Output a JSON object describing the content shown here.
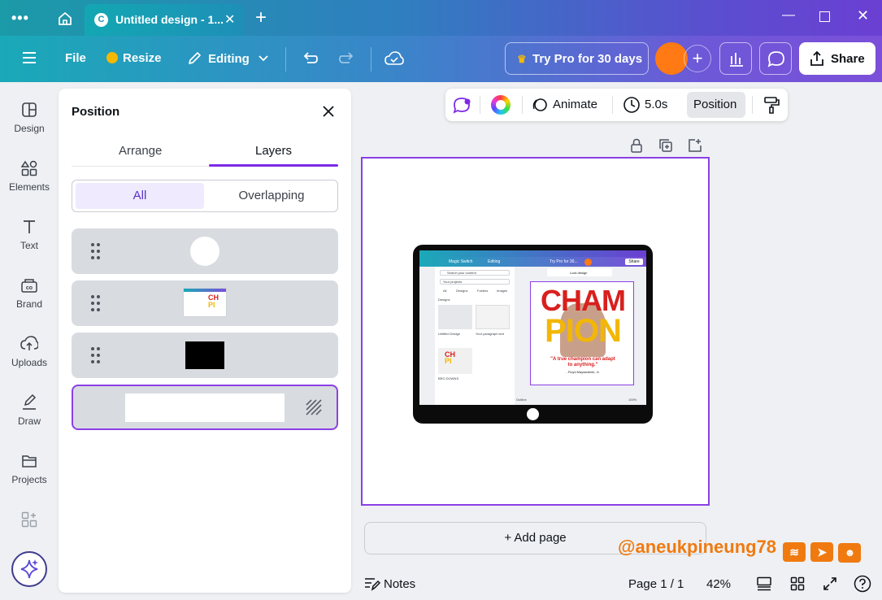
{
  "window": {
    "tab_title": "Untitled design - 1...",
    "tab_logo": "C"
  },
  "toolbar": {
    "file": "File",
    "resize": "Resize",
    "editing": "Editing",
    "try_pro": "Try Pro for 30 days",
    "share": "Share",
    "brand_color": "#ff7a14"
  },
  "rail": [
    {
      "label": "Design",
      "icon": "design-icon"
    },
    {
      "label": "Elements",
      "icon": "elements-icon"
    },
    {
      "label": "Text",
      "icon": "text-icon"
    },
    {
      "label": "Brand",
      "icon": "brand-icon"
    },
    {
      "label": "Uploads",
      "icon": "uploads-icon"
    },
    {
      "label": "Draw",
      "icon": "draw-icon"
    },
    {
      "label": "Projects",
      "icon": "projects-icon"
    }
  ],
  "panel": {
    "title": "Position",
    "tabs": [
      "Arrange",
      "Layers"
    ],
    "active_tab": "Layers",
    "filters": [
      "All",
      "Overlapping"
    ],
    "active_filter": "All",
    "layers": [
      {
        "kind": "circle"
      },
      {
        "kind": "screenshot"
      },
      {
        "kind": "black-rect"
      },
      {
        "kind": "background",
        "selected": true
      }
    ]
  },
  "element_toolbar": {
    "animate": "Animate",
    "duration": "5.0s",
    "position": "Position"
  },
  "canvas": {
    "add_page": "+ Add page",
    "watermark": "@aneukpineung78",
    "mini": {
      "big_word_1": "CHAM",
      "big_word_2": "PION",
      "quote": "\"A true champion can adapt to anything.\"",
      "author": "- Floyd Mayweather, Jr.",
      "search_placeholder": "Search your content",
      "projects": "Your projects",
      "filters": [
        "All",
        "Designs",
        "Folders",
        "Images"
      ],
      "section": "Designs",
      "thumb1_title": "Untitled Design",
      "thumb2_title": "Your paragraph text",
      "thumb3_title": "BRO DOWNS",
      "share": "Share",
      "editing": "Editing",
      "magic": "Magic Switch",
      "try_pro": "Try Pro for 30...",
      "lock_design": "Lock design",
      "zoom": "100%",
      "outline": "Outline"
    }
  },
  "bottom": {
    "notes": "Notes",
    "page": "Page 1 / 1",
    "zoom": "42%"
  }
}
